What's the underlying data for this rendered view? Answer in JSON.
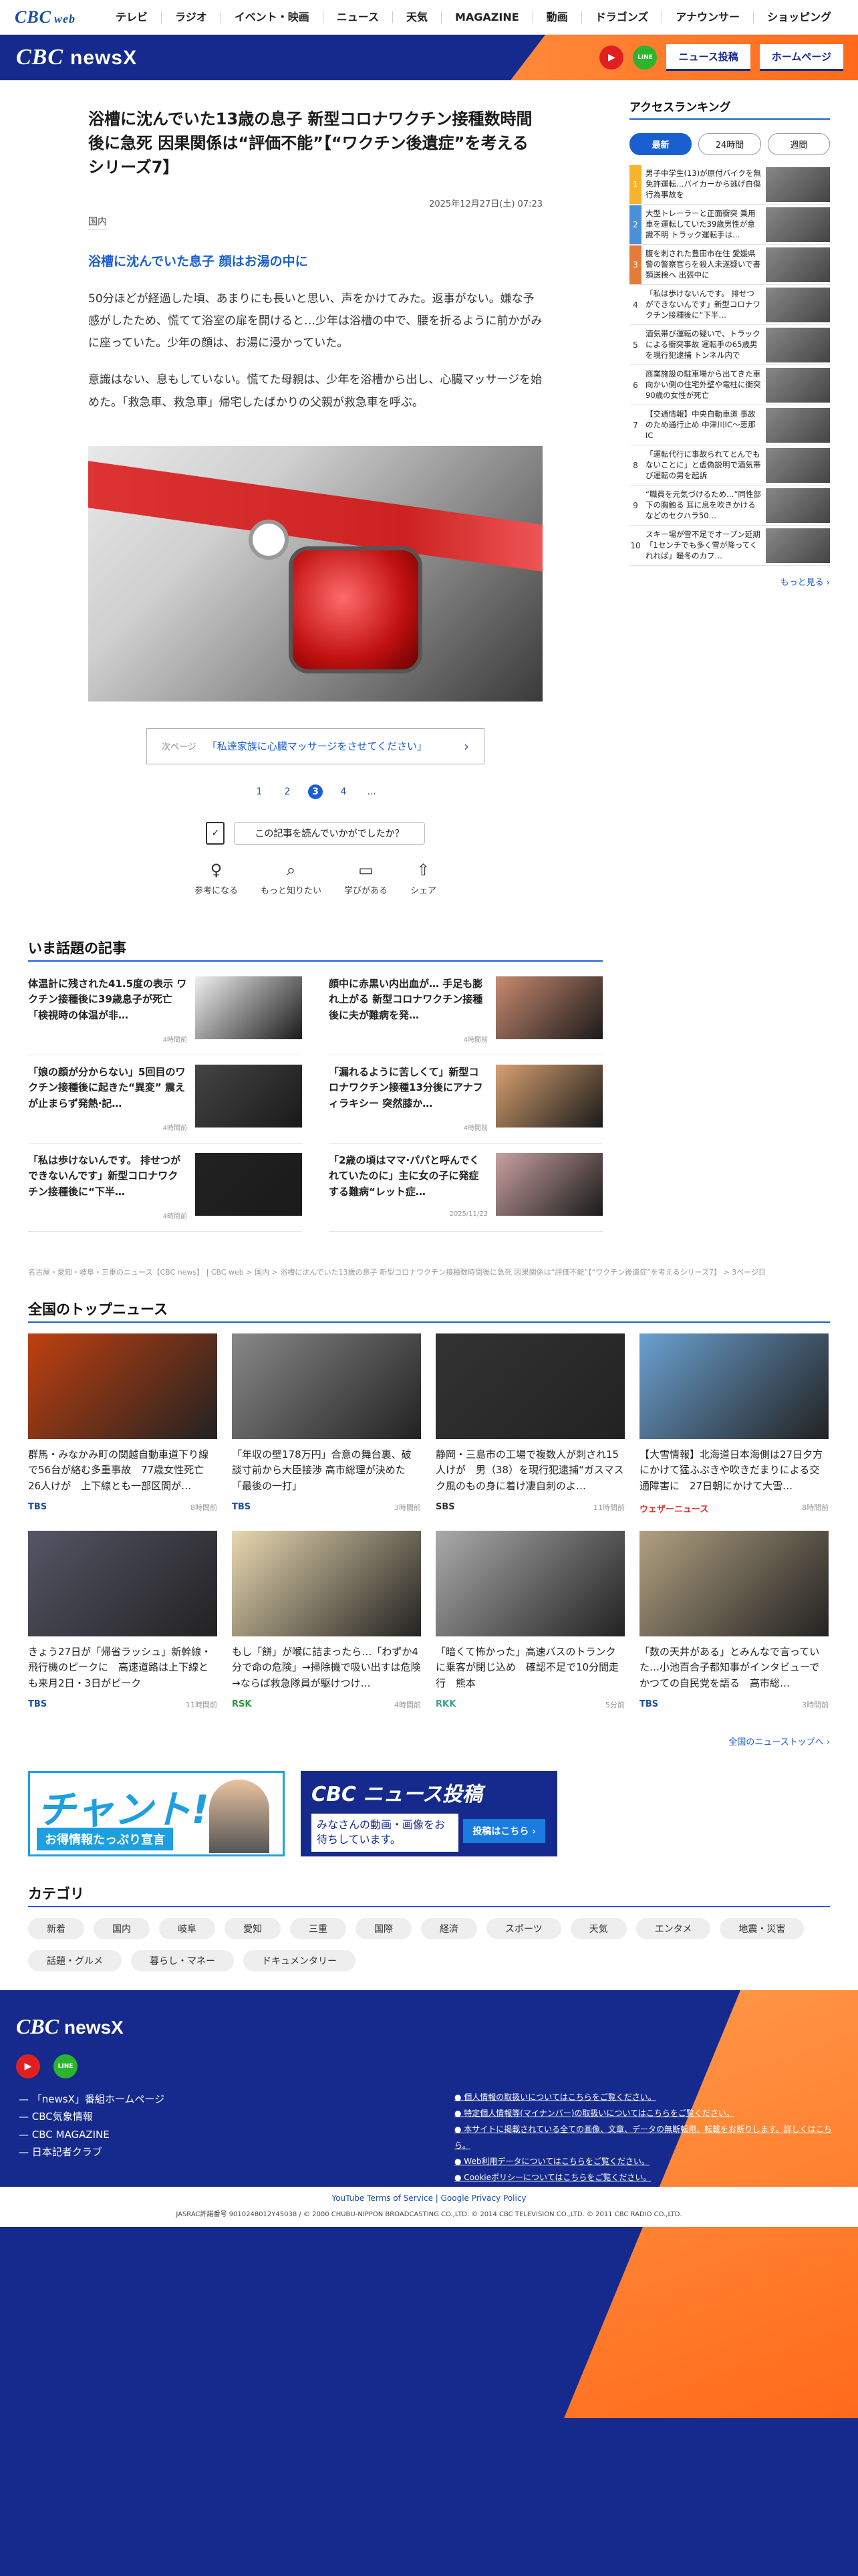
{
  "topnav": {
    "logo": "CBC",
    "logo_sub": "web",
    "items": [
      "テレビ",
      "ラジオ",
      "イベント・映画",
      "ニュース",
      "天気",
      "MAGAZINE",
      "動画",
      "ドラゴンズ",
      "アナウンサー",
      "ショッピング"
    ]
  },
  "brand": {
    "logo": "CBC",
    "name": "newsX",
    "yt_label": "▶",
    "line_label": "LINE",
    "btn_post": "ニュース投稿",
    "btn_home": "ホームページ"
  },
  "article": {
    "headline": "浴槽に沈んでいた13歳の息子 新型コロナワクチン接種数時間後に急死 因果関係は“評価不能”【“ワクチン後遺症”を考えるシリーズ7】",
    "date": "2025年12月27日(土) 07:23",
    "category": "国内",
    "subhead": "浴槽に沈んでいた息子 顔はお湯の中に",
    "para1": "50分ほどが経過した頃、あまりにも長いと思い、声をかけてみた。返事がない。嫌な予感がしたため、慌てて浴室の扉を開けると…少年は浴槽の中で、腰を折るように前かがみに座っていた。少年の顔は、お湯に浸かっていた。",
    "para2": "意識はない、息もしていない。慌てた母親は、少年を浴槽から出し、心臓マッサージを始めた。「救急車、救急車」帰宅したばかりの父親が救急車を呼ぶ。",
    "next_label": "次ページ",
    "next_text": "「私達家族に心臓マッサージをさせてください」",
    "next_arrow": "›",
    "pages": [
      "1",
      "2",
      "3",
      "4",
      "..."
    ],
    "ask_text": "この記事を読んでいかがでしたか？",
    "reactions": [
      {
        "icon": "♀",
        "label": "参考になる"
      },
      {
        "icon": "⌕",
        "label": "もっと知りたい"
      },
      {
        "icon": "▭",
        "label": "学びがある"
      },
      {
        "icon": "⇧",
        "label": "シェア"
      }
    ]
  },
  "ranking": {
    "title": "アクセスランキング",
    "tabs": [
      "最新",
      "24時間",
      "週間"
    ],
    "items": [
      {
        "n": "1",
        "text": "男子中学生(13)が原付バイクを無免許運転…バイカーから逃げ自傷行為事故を",
        "color": "#f7b32b"
      },
      {
        "n": "2",
        "text": "大型トレーラーと正面衝突 乗用車を運転していた39歳男性が意識不明 トラック運転手は…",
        "color": "#4a90d9"
      },
      {
        "n": "3",
        "text": "腹を刺された豊田市在住 愛媛県警の警察官らを殺人未遂疑いで書類送検へ 出張中に",
        "color": "#e67a3a"
      },
      {
        "n": "4",
        "text": "「私は歩けないんです。 排せつができないんです」新型コロナワクチン接種後に“下半…",
        "color": ""
      },
      {
        "n": "5",
        "text": "酒気帯び運転の疑いで、トラックによる衝突事故 運転手の65歳男を現行犯逮捕 トンネル内で",
        "color": ""
      },
      {
        "n": "6",
        "text": "商業施設の駐車場から出てきた車 向かい側の住宅外壁や電柱に衝突 90歳の女性が死亡",
        "color": ""
      },
      {
        "n": "7",
        "text": "【交通情報】中央自動車道 事故のため通行止め 中津川IC〜恵那IC",
        "color": ""
      },
      {
        "n": "8",
        "text": "「運転代行に事故られてとんでもないことに」と虚偽説明で酒気帯び運転の男を起訴",
        "color": ""
      },
      {
        "n": "9",
        "text": "“職員を元気づけるため…”同性部下の胸触る 耳に息を吹きかけるなどのセクハラ50…",
        "color": ""
      },
      {
        "n": "10",
        "text": "スキー場が雪不足でオープン延期「1センチでも多く雪が降ってくれれば」暖冬のカフ…",
        "color": ""
      }
    ],
    "more": "もっと見る ›"
  },
  "trending": {
    "title": "いま話題の記事",
    "items": [
      {
        "text": "体温計に残された41.5度の表示 ワクチン接種後に39歳息子が死亡「検視時の体温が非…",
        "ago": "4時間前"
      },
      {
        "text": "顔中に赤黒い内出血が… 手足も膨れ上がる 新型コロナワクチン接種後に夫が難病を発…",
        "ago": "4時間前"
      },
      {
        "text": "「娘の顔が分からない」5回目のワクチン接種後に起きた“異変” 震えが止まらず発熱·記…",
        "ago": "4時間前"
      },
      {
        "text": "「漏れるように苦しくて」新型コロナワクチン接種13分後にアナフィラキシー 突然膝か…",
        "ago": "4時間前"
      },
      {
        "text": "「私は歩けないんです。 排せつができないんです」新型コロナワクチン接種後に“下半…",
        "ago": "4時間前"
      },
      {
        "text": "「2歳の頃はママ·パパと呼んでくれていたのに」主に女の子に発症する難病“レット症…",
        "ago": "2025/11/23"
      }
    ]
  },
  "breadcrumb": "名古屋・愛知・岐阜・三重のニュース【CBC news】 | CBC web > 国内 > 浴槽に沈んでいた13歳の息子 新型コロナワクチン接種数時間後に急死 因果関係は“評価不能”【“ワクチン後遺症”を考えるシリーズ7】 > 3ページ目",
  "topnews": {
    "title": "全国のトップニュース",
    "items": [
      {
        "text": "群馬・みなかみ町の関越自動車道下り線で56台が絡む多重事故　77歳女性死亡 26人けが　上下線とも一部区間が…",
        "src": "TBS",
        "src_color": "#1a4fa3",
        "ago": "8時間前"
      },
      {
        "text": "「年収の壁178万円」合意の舞台裏、破談寸前から大臣接渉 高市総理が決めた「最後の一打」",
        "src": "TBS",
        "src_color": "#1a4fa3",
        "ago": "3時間前"
      },
      {
        "text": "静岡・三島市の工場で複数人が刺され15人けが　男（38）を現行犯逮捕“ガスマスク風のもの身に着け凄自刺のよ…",
        "src": "SBS",
        "src_color": "#333333",
        "ago": "11時間前"
      },
      {
        "text": "【大雪情報】北海道日本海側は27日夕方にかけて猛ふぶきや吹きだまりによる交通障害に　27日朝にかけて大雪…",
        "src": "ウェザーニュース",
        "src_color": "#e03030",
        "ago": "8時間前"
      },
      {
        "text": "きょう27日が「帰省ラッシュ」新幹線・飛行機のピークに　高速道路は上下線とも来月2日・3日がピーク",
        "src": "TBS",
        "src_color": "#1a4fa3",
        "ago": "11時間前"
      },
      {
        "text": "もし「餅」が喉に詰まったら…「わずか4分で命の危険」→掃除機で吸い出すは危険→ならば救急隊員が駆けつけ…",
        "src": "RSK",
        "src_color": "#2a9a3a",
        "ago": "4時間前"
      },
      {
        "text": "「暗くて怖かった」高速バスのトランクに乗客が閉じ込め　確認不足で10分間走行　熊本",
        "src": "RKK",
        "src_color": "#3aa090",
        "ago": "5分前"
      },
      {
        "text": "「数の天井がある」とみんなで言っていた…小池百合子都知事がインタビューでかつての自民党を語る　高市総…",
        "src": "TBS",
        "src_color": "#1a4fa3",
        "ago": "3時間前"
      }
    ],
    "all": "全国のニューストップへ ›"
  },
  "banners": {
    "chant_big": "チャント!",
    "chant_sub": "お得情報たっぷり宣言",
    "post_title": "CBC ニュース投稿",
    "post_text": "みなさんの動画・画像をお待ちしています。",
    "post_btn": "投稿はこちら ›"
  },
  "categories": {
    "title": "カテゴリ",
    "items": [
      "新着",
      "国内",
      "岐阜",
      "愛知",
      "三重",
      "国際",
      "経済",
      "スポーツ",
      "天気",
      "エンタメ",
      "地震・災害",
      "話題・グルメ",
      "暮らし・マネー",
      "ドキュメンタリー"
    ]
  },
  "footer": {
    "logo": "CBC",
    "name": "newsX",
    "yt_label": "▶",
    "line_label": "LINE",
    "links": [
      "「newsX」番組ホームページ",
      "CBC気象情報",
      "CBC MAGAZINE",
      "日本記者クラブ"
    ],
    "policies": [
      "個人情報の取扱いについてはこちらをご覧ください。",
      "特定個人情報等(マイナンバー)の取扱いについてはこちらをご覧ください。",
      "本サイトに掲載されている全ての画像、文章、データの無断転用、転載をお断りします。詳しくはこちら。",
      "Web利用データについてはこちらをご覧ください。",
      "Cookieポリシーについてはこちらをご覧ください。"
    ],
    "google": "YouTube Terms of Service | Google Privacy Policy",
    "copyright": "JASRAC許諾番号 9010248012Y45038 / © 2000 CHUBU-NIPPON BROADCASTING CO.,LTD. © 2014 CBC TELEVISION CO.,LTD. © 2011 CBC RADIO CO.,LTD."
  }
}
